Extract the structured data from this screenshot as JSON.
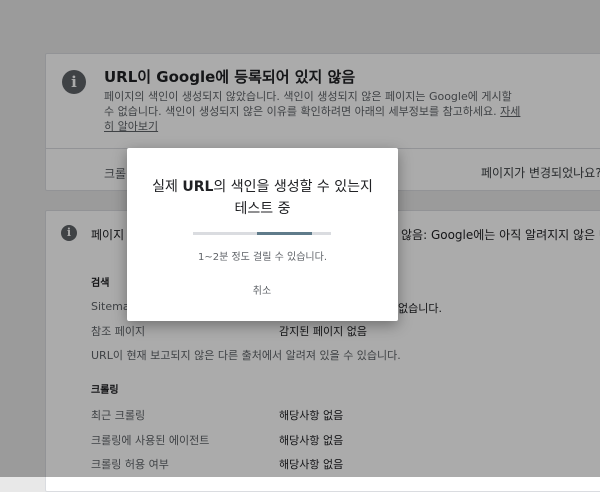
{
  "card1": {
    "title": "URL이 Google에 등록되어 있지 않음",
    "description": "페이지의 색인이 생성되지 않았습니다. 색인이 생성되지 않은 페이지는 Google에 게시할 수 없습니다. 색인이 생성되지 않은 이유를 확인하려면 아래의 세부정보를 참고하세요.",
    "learn_more": "자세히 알아보기",
    "partial_button": "크롤",
    "changed_question": "페이지가 변경되었나요?"
  },
  "card2": {
    "header_left": "페이지",
    "header_right": "않음: Google에는 아직 알려지지 않은 URL",
    "discovery": {
      "title": "검색",
      "sitemap_label": "Sitema",
      "sitemap_value": "없습니다.",
      "referring_label": "참조 페이지",
      "referring_value": "감지된 페이지 없음",
      "note": "URL이 현재 보고되지 않은 다른 출처에서 알려져 있을 수 있습니다."
    },
    "crawl": {
      "title": "크롤링",
      "rows": [
        {
          "label": "최근 크롤링",
          "value": "해당사항 없음"
        },
        {
          "label": "크롤링에 사용된 에이전트",
          "value": "해당사항 없음"
        },
        {
          "label": "크롤링 허용 여부",
          "value": "해당사항 없음"
        }
      ]
    }
  },
  "dialog": {
    "title_pre": "실제 ",
    "title_bold": "URL",
    "title_post": "의 색인을 생성할 수 있는지 테스트 중",
    "progress_fraction": 0.5,
    "subtitle": "1~2분 정도 걸릴 수 있습니다.",
    "cancel": "취소"
  },
  "colors": {
    "progress": "#5f7b8a",
    "track": "#dadce0"
  }
}
